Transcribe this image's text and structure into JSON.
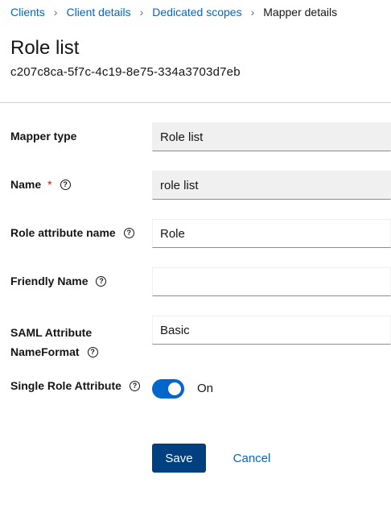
{
  "breadcrumb": {
    "items": [
      "Clients",
      "Client details",
      "Dedicated scopes"
    ],
    "current": "Mapper details",
    "separator": "›"
  },
  "header": {
    "title": "Role list",
    "client_id": "c207c8ca-5f7c-4c19-8e75-334a3703d7eb"
  },
  "form": {
    "mapper_type": {
      "label": "Mapper type",
      "value": "Role list"
    },
    "name": {
      "label": "Name",
      "required_mark": "*",
      "value": "role list"
    },
    "role_attribute_name": {
      "label": "Role attribute name",
      "value": "Role"
    },
    "friendly_name": {
      "label": "Friendly Name",
      "value": ""
    },
    "saml_attribute_nameformat": {
      "label_line1": "SAML Attribute",
      "label_line2": "NameFormat",
      "value": "Basic"
    },
    "single_role_attribute": {
      "label": "Single Role Attribute",
      "state_label": "On",
      "enabled": true
    },
    "help_glyph": "?"
  },
  "actions": {
    "save_label": "Save",
    "cancel_label": "Cancel"
  },
  "colors": {
    "accent": "#0066cc",
    "primary_button": "#004080",
    "required": "#c9190b",
    "readonly_bg": "#f0f0f0"
  }
}
